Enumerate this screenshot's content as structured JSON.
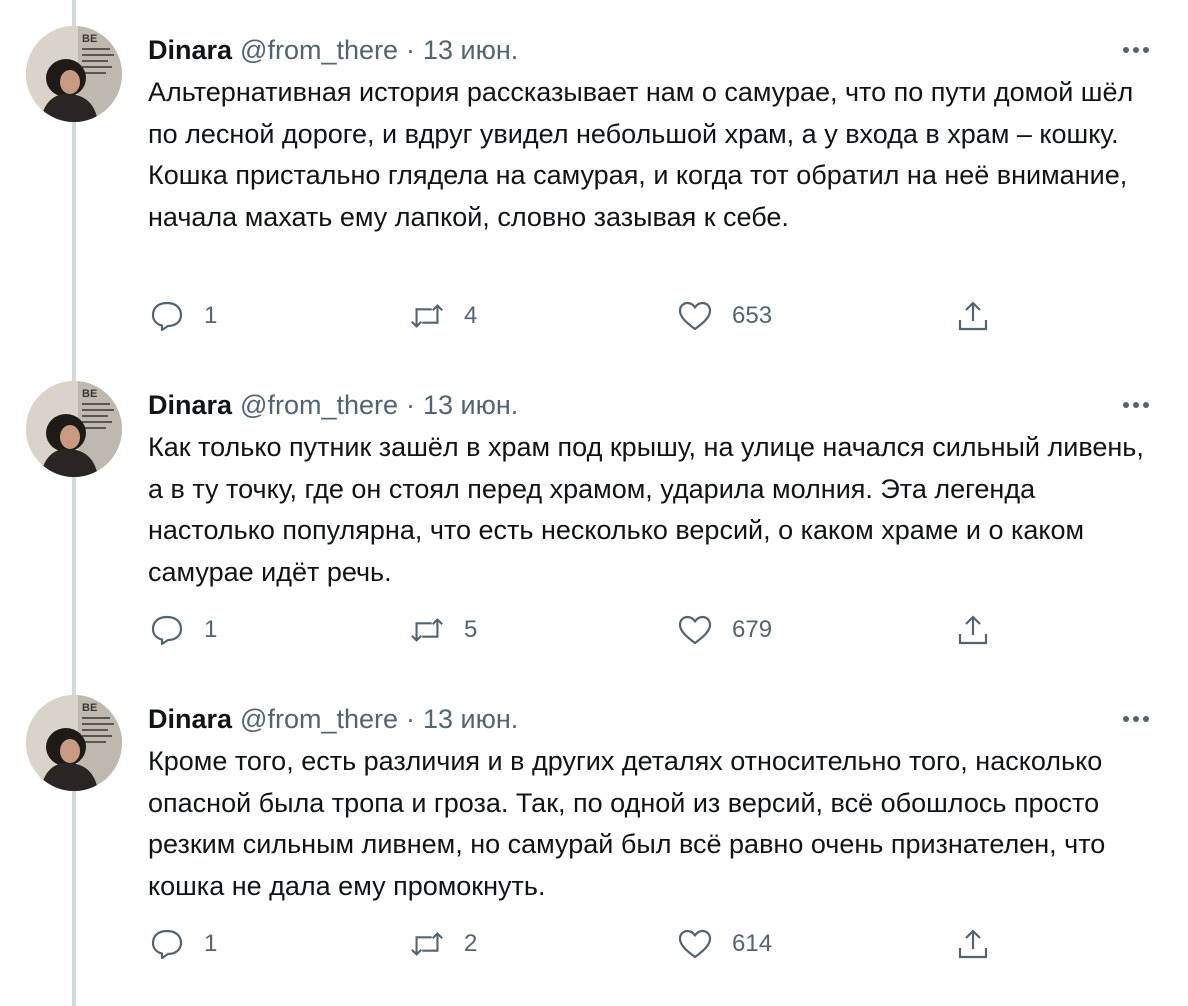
{
  "tweets": [
    {
      "author": {
        "name": "Dinara",
        "handle": "@from_there"
      },
      "separator": "·",
      "date": "13 июн.",
      "text": "Альтернативная история рассказывает нам о самурае, что по пути домой шёл по лесной дороге, и вдруг увидел небольшой храм, а у входа в храм – кошку. Кошка пристально глядела на самурая, и когда тот обратил на неё внимание, начала махать ему лапкой, словно зазывая к себе.",
      "replies": "1",
      "retweets": "4",
      "likes": "653"
    },
    {
      "author": {
        "name": "Dinara",
        "handle": "@from_there"
      },
      "separator": "·",
      "date": "13 июн.",
      "text": "Как только путник зашёл в храм под крышу, на улице начался сильный ливень, а в ту точку, где он стоял перед храмом, ударила молния. Эта легенда настолько популярна, что есть несколько версий, о каком храме и о каком самурае идёт речь.",
      "replies": "1",
      "retweets": "5",
      "likes": "679"
    },
    {
      "author": {
        "name": "Dinara",
        "handle": "@from_there"
      },
      "separator": "·",
      "date": "13 июн.",
      "text": "Кроме того, есть различия и в других деталях относительно того, насколько опасной была тропа и гроза. Так, по одной из версий, всё обошлось просто резким сильным ливнем, но самурай был всё равно очень признателен, что кошка не дала ему промокнуть.",
      "replies": "1",
      "retweets": "2",
      "likes": "614"
    }
  ],
  "icons": {
    "avatar": "avatar",
    "more": "more-icon",
    "reply": "reply-icon",
    "retweet": "retweet-icon",
    "like": "like-icon",
    "share": "share-icon"
  },
  "colors": {
    "text": "#0f1419",
    "secondary": "#536471",
    "thread_line": "#cfd9de"
  }
}
